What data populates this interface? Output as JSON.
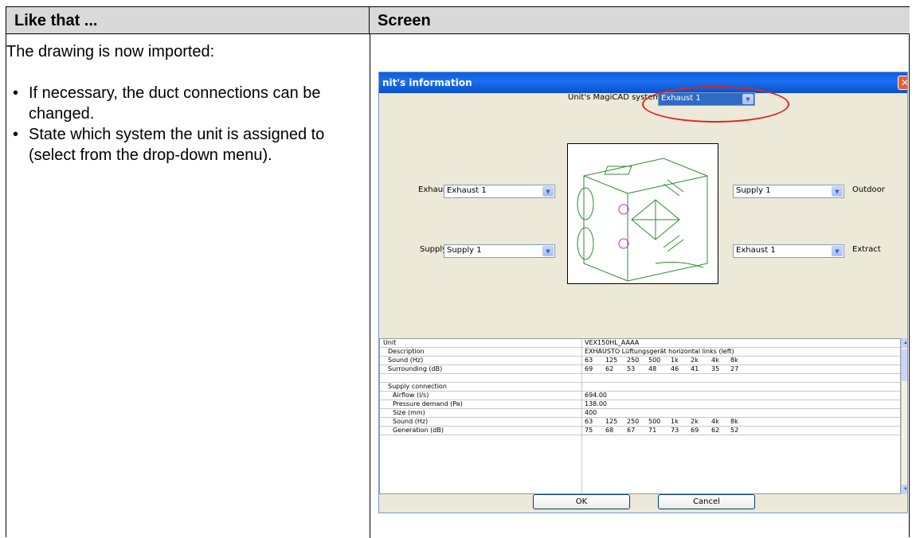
{
  "table": {
    "col_left_header": "Like that ...",
    "col_right_header": "Screen"
  },
  "instructions": {
    "intro": "The drawing is now imported:",
    "bullets": [
      "If necessary, the duct connections can be changed.",
      "State which system the unit is assigned to (select from the drop-down menu)."
    ]
  },
  "dialog": {
    "title": "nit's information",
    "system_label": "Unit's MagiCAD system",
    "system_value": "Exhaust 1",
    "exhaust_label": "Exhaust",
    "exhaust_value": "Exhaust 1",
    "supply_label": "Supply",
    "supply_value": "Supply 1",
    "outdoor_value": "Supply 1",
    "outdoor_label": "Outdoor",
    "extract_value": "Exhaust 1",
    "extract_label": "Extract",
    "ok_label": "OK",
    "cancel_label": "Cancel",
    "highlight_color": "#e0231e"
  },
  "grid_rows": [
    {
      "name": "Unit",
      "values": [
        "VEX150HL_AAAA"
      ],
      "indent": 0
    },
    {
      "name": "Description",
      "values": [
        "EXHAUSTO Lüftungsgerät horizontal links (left)"
      ],
      "indent": 1
    },
    {
      "name": "Sound (Hz)",
      "values": [
        "63",
        "125",
        "250",
        "500",
        "1k",
        "2k",
        "4k",
        "8k"
      ],
      "indent": 1
    },
    {
      "name": "Surrounding (dB)",
      "values": [
        "69",
        "62",
        "53",
        "48",
        "46",
        "41",
        "35",
        "27"
      ],
      "indent": 1
    },
    {
      "name": "",
      "values": [],
      "indent": 0
    },
    {
      "name": "Supply connection",
      "values": [],
      "indent": 1
    },
    {
      "name": "Airflow (l/s)",
      "values": [
        "694.00"
      ],
      "indent": 2
    },
    {
      "name": "Pressure demand (Pa)",
      "values": [
        "138.00"
      ],
      "indent": 2
    },
    {
      "name": "Size (mm)",
      "values": [
        "400"
      ],
      "indent": 2
    },
    {
      "name": "Sound (Hz)",
      "values": [
        "63",
        "125",
        "250",
        "500",
        "1k",
        "2k",
        "4k",
        "8k"
      ],
      "indent": 2
    },
    {
      "name": "Generation (dB)",
      "values": [
        "75",
        "68",
        "67",
        "71",
        "73",
        "69",
        "62",
        "52"
      ],
      "indent": 2
    }
  ]
}
